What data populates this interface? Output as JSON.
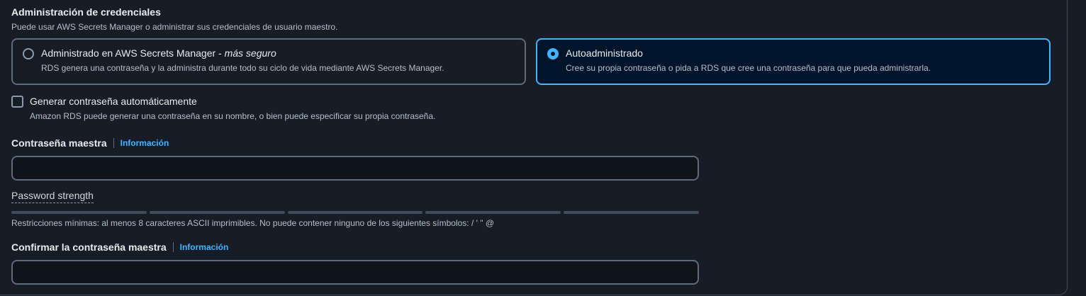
{
  "section": {
    "title": "Administración de credenciales",
    "description": "Puede usar AWS Secrets Manager o administrar sus credenciales de usuario maestro."
  },
  "options": [
    {
      "label": "Administrado en AWS Secrets Manager - ",
      "label_em": "más seguro",
      "description": "RDS genera una contraseña y la administra durante todo su ciclo de vida mediante AWS Secrets Manager.",
      "selected": false
    },
    {
      "label": "Autoadministrado",
      "description": "Cree su propia contraseña o pida a RDS que cree una contraseña para que pueda administrarla.",
      "selected": true
    }
  ],
  "auto_password": {
    "label": "Generar contraseña automáticamente",
    "description": "Amazon RDS puede generar una contraseña en su nombre, o bien puede especificar su propia contraseña.",
    "checked": false
  },
  "master_password": {
    "label": "Contraseña maestra",
    "info": "Información",
    "value": ""
  },
  "strength": {
    "label": "Password strength",
    "segments_filled": 0,
    "segments_total": 5
  },
  "constraints": "Restricciones mínimas: al menos 8 caracteres ASCII imprimibles. No puede contener ninguno de los siguientes símbolos: / ' \" @",
  "confirm_password": {
    "label": "Confirmar la contraseña maestra",
    "info": "Información",
    "value": ""
  },
  "colors": {
    "accent": "#42b4ff",
    "background": "#161d26"
  }
}
